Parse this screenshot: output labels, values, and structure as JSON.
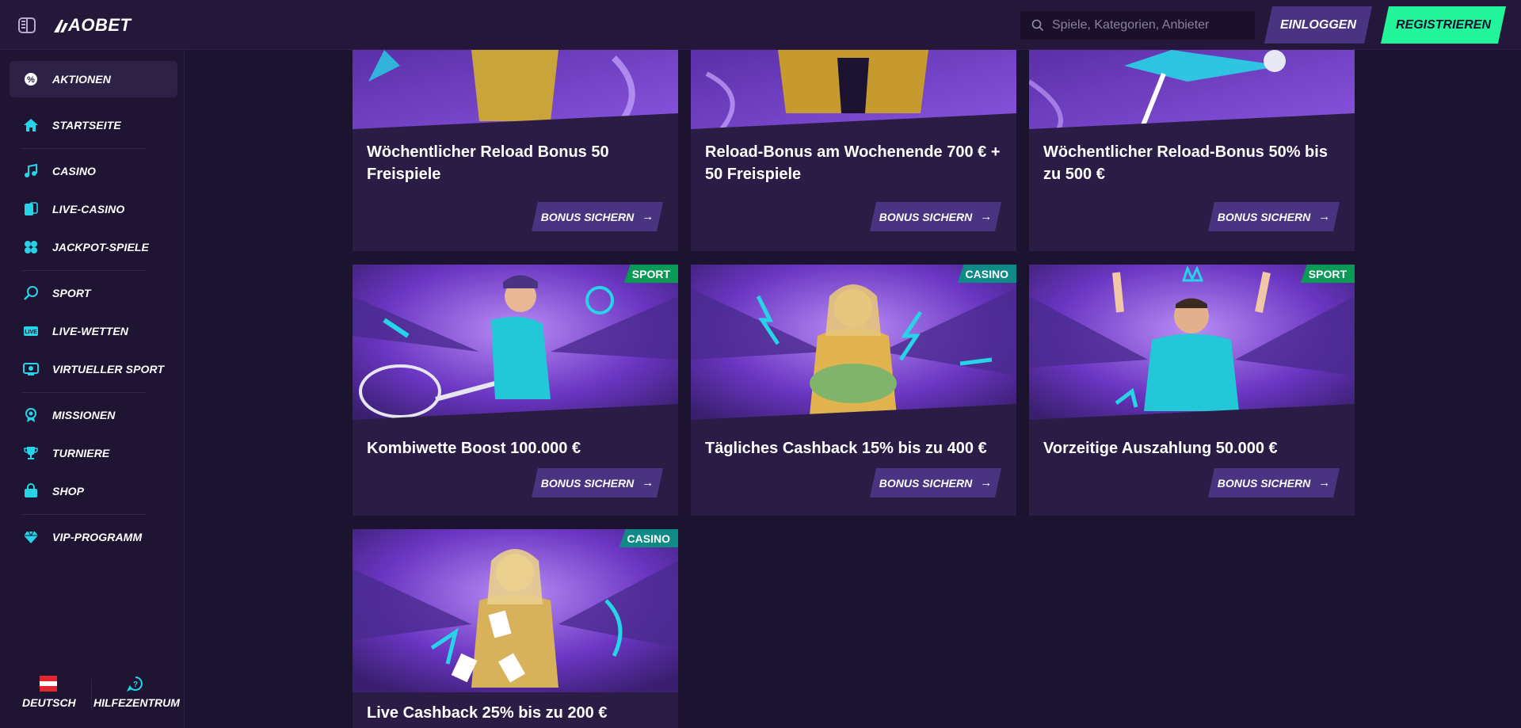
{
  "header": {
    "logo_text": "AOBET",
    "search_placeholder": "Spiele, Kategorien, Anbieter",
    "login_label": "EINLOGGEN",
    "register_label": "REGISTRIEREN"
  },
  "sidebar": {
    "items": [
      {
        "label": "AKTIONEN",
        "icon": "promotions-icon"
      },
      {
        "label": "STARTSEITE",
        "icon": "home-icon"
      },
      {
        "label": "CASINO",
        "icon": "casino-icon"
      },
      {
        "label": "LIVE-CASINO",
        "icon": "live-casino-icon"
      },
      {
        "label": "JACKPOT-SPIELE",
        "icon": "clover-icon"
      },
      {
        "label": "SPORT",
        "icon": "sport-icon"
      },
      {
        "label": "LIVE-WETTEN",
        "icon": "live-badge-icon"
      },
      {
        "label": "VIRTUELLER SPORT",
        "icon": "virtual-sport-icon"
      },
      {
        "label": "MISSIONEN",
        "icon": "medal-icon"
      },
      {
        "label": "TURNIERE",
        "icon": "trophy-icon"
      },
      {
        "label": "SHOP",
        "icon": "shopping-bag-icon"
      },
      {
        "label": "VIP-PROGRAMM",
        "icon": "diamond-icon"
      }
    ],
    "language_label": "DEUTSCH",
    "help_label": "HILFEZENTRUM"
  },
  "promotions": [
    {
      "title": "Wöchentlicher Reload Bonus 50 Freispiele",
      "button": "BONUS SICHERN",
      "tag": ""
    },
    {
      "title": "Reload-Bonus am Wochenende 700 € + 50 Freispiele",
      "button": "BONUS SICHERN",
      "tag": ""
    },
    {
      "title": "Wöchentlicher Reload-Bonus 50% bis zu 500 €",
      "button": "BONUS SICHERN",
      "tag": ""
    },
    {
      "title": "Kombiwette Boost 100.000 €",
      "button": "BONUS SICHERN",
      "tag": "SPORT"
    },
    {
      "title": "Tägliches Cashback 15% bis zu 400 €",
      "button": "BONUS SICHERN",
      "tag": "CASINO"
    },
    {
      "title": "Vorzeitige Auszahlung 50.000 €",
      "button": "BONUS SICHERN",
      "tag": "SPORT"
    },
    {
      "title": "Live Cashback 25% bis zu 200 €",
      "button": "",
      "tag": "CASINO"
    }
  ],
  "colors": {
    "accent_green": "#23f59a",
    "button_purple": "#4a3380",
    "card_bg": "#2a1c45",
    "icon_cyan": "#27d3e6"
  }
}
